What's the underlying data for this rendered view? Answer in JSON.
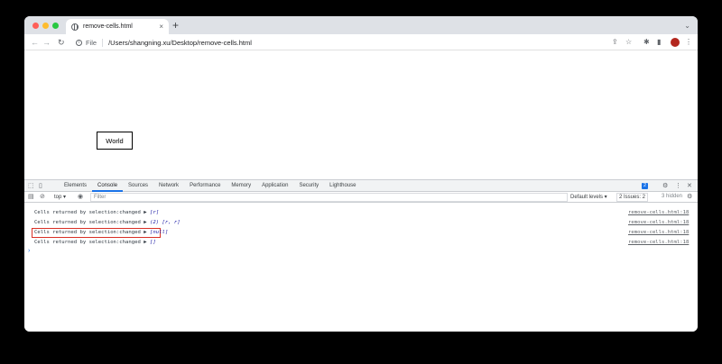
{
  "browser": {
    "tab_title": "remove-cells.html",
    "tab_close": "×",
    "new_tab": "+",
    "tabs_menu": "⌄",
    "nav": {
      "back": "←",
      "forward": "→",
      "reload": "↻"
    },
    "omnibox": {
      "info": "i",
      "scheme": "File",
      "url": "/Users/shangning.xu/Desktop/remove-cells.html"
    },
    "toolbar_icons": {
      "share": "⇪",
      "bookmark": "☆",
      "extensions": "✱",
      "sidepanel": "▮",
      "menu": "⋮"
    }
  },
  "page": {
    "cell_text": "World"
  },
  "devtools": {
    "tabs": [
      "Elements",
      "Console",
      "Sources",
      "Network",
      "Performance",
      "Memory",
      "Application",
      "Security",
      "Lighthouse"
    ],
    "active_tab": "Console",
    "issues_badge": "2",
    "icons": {
      "inspect": "⬚",
      "device": "▯",
      "settings": "⚙",
      "more": "⋮",
      "close": "✕"
    },
    "console_toolbar": {
      "sidebar": "▤",
      "clear": "⊘",
      "context": "top ▾",
      "eye": "◉",
      "filter_placeholder": "Filter",
      "levels": "Default levels ▾",
      "issues": "2 Issues: 2",
      "hidden": "3 hidden",
      "settings": "⚙"
    },
    "logs": [
      {
        "prefix": "Cells returned by selection:changed ▶",
        "value": "[r]",
        "source": "remove-cells.html:18"
      },
      {
        "prefix": "Cells returned by selection:changed ▶",
        "value": "(2) [r, r]",
        "source": "remove-cells.html:18"
      },
      {
        "prefix": "Cells returned by selection:changed ▶",
        "value": "[null]",
        "source": "remove-cells.html:18"
      },
      {
        "prefix": "Cells returned by selection:changed ▶",
        "value": "[]",
        "source": "remove-cells.html:18"
      }
    ],
    "prompt": "›"
  }
}
